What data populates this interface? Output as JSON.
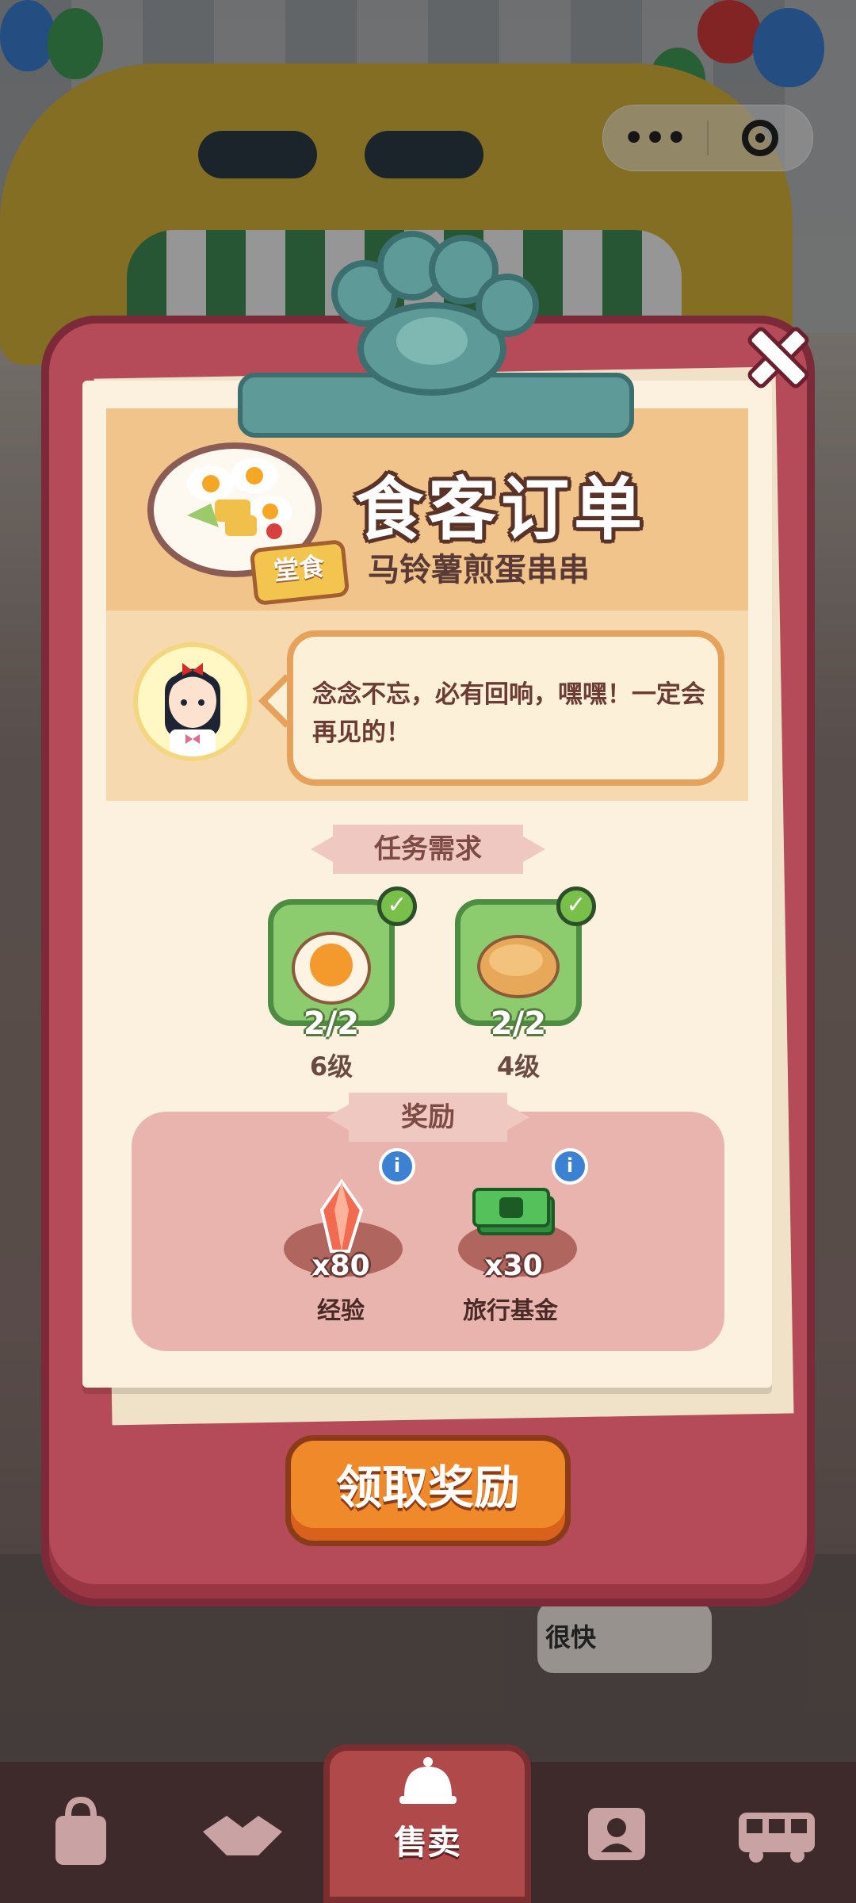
{
  "top_bar": {
    "menu_dots": "•••",
    "capsule_icons": [
      "more-dots-icon",
      "close-circle-icon"
    ]
  },
  "order": {
    "title": "食客订单",
    "dish_name": "马铃薯煎蛋串串",
    "dine_tag": "堂食"
  },
  "customer": {
    "speech": "念念不忘，必有回响，嘿嘿！一定会再见的！"
  },
  "requirements": {
    "section_title": "任务需求",
    "items": [
      {
        "icon": "boiled-egg-icon",
        "count": "2/2",
        "level": "6级",
        "done": true
      },
      {
        "icon": "bread-bun-icon",
        "count": "2/2",
        "level": "4级",
        "done": true
      }
    ]
  },
  "rewards": {
    "section_title": "奖励",
    "items": [
      {
        "icon": "crystal-icon",
        "count": "x80",
        "label": "经验"
      },
      {
        "icon": "money-stack-icon",
        "count": "x30",
        "label": "旅行基金"
      }
    ]
  },
  "claim_button": "领取奖励",
  "background": {
    "bubble_text": "很快"
  },
  "bottom_nav": {
    "items": [
      {
        "icon": "bag-icon",
        "label": ""
      },
      {
        "icon": "handshake-icon",
        "label": ""
      },
      {
        "icon": "service-bell-icon",
        "label": "售卖"
      },
      {
        "icon": "contact-card-icon",
        "label": ""
      },
      {
        "icon": "bus-icon",
        "label": ""
      }
    ]
  },
  "colors": {
    "board": "#b54a58",
    "paper": "#fbf1de",
    "claim_button": "#f0892a",
    "card_green": "#8ccc6e",
    "clip_teal": "#5e9b98"
  }
}
